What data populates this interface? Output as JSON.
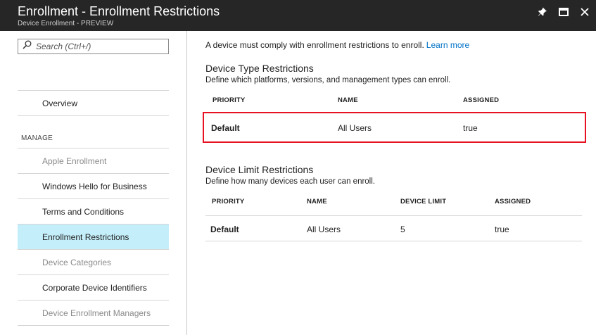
{
  "header": {
    "title": "Enrollment - Enrollment Restrictions",
    "subtitle": "Device Enrollment - PREVIEW",
    "icons": [
      "pin-icon",
      "maximize-icon",
      "close-icon"
    ]
  },
  "sidebar": {
    "search_placeholder": "Search (Ctrl+/)",
    "overview": "Overview",
    "section_label": "MANAGE",
    "items": [
      {
        "label": "Apple Enrollment",
        "state": "disabled"
      },
      {
        "label": "Windows Hello for Business",
        "state": "normal"
      },
      {
        "label": "Terms and Conditions",
        "state": "normal"
      },
      {
        "label": "Enrollment Restrictions",
        "state": "active"
      },
      {
        "label": "Device Categories",
        "state": "disabled"
      },
      {
        "label": "Corporate Device Identifiers",
        "state": "normal"
      },
      {
        "label": "Device Enrollment Managers",
        "state": "disabled"
      }
    ]
  },
  "main": {
    "intro_text": "A device must comply with enrollment restrictions to enroll.",
    "intro_link": "Learn more",
    "device_type": {
      "title": "Device Type Restrictions",
      "description": "Define which platforms, versions, and management types can enroll.",
      "columns": [
        "PRIORITY",
        "NAME",
        "ASSIGNED"
      ],
      "rows": [
        [
          "Default",
          "All Users",
          "true"
        ]
      ]
    },
    "device_limit": {
      "title": "Device Limit Restrictions",
      "description": "Define how many devices each user can enroll.",
      "columns": [
        "PRIORITY",
        "NAME",
        "DEVICE LIMIT",
        "ASSIGNED"
      ],
      "rows": [
        [
          "Default",
          "All Users",
          "5",
          "true"
        ]
      ]
    }
  },
  "colors": {
    "header_bg": "#262626",
    "active_bg": "#c4eefa",
    "link": "#0072c6",
    "highlight_border": "#e81123"
  }
}
